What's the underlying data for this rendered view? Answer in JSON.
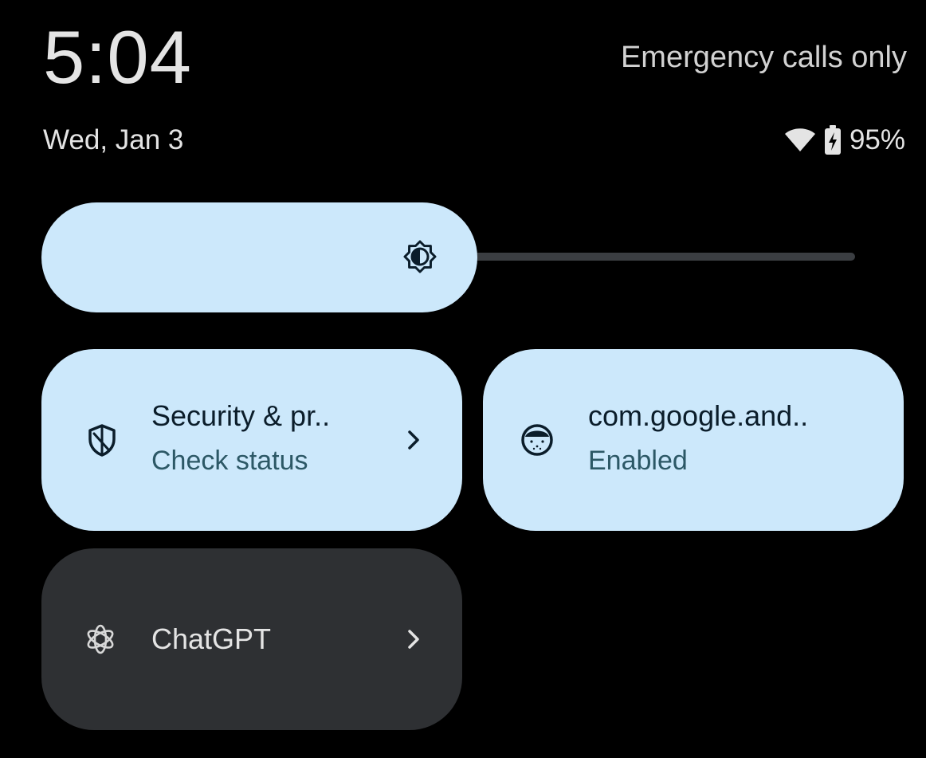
{
  "status_bar": {
    "time": "5:04",
    "carrier": "Emergency calls only",
    "date": "Wed, Jan 3",
    "battery": "95%",
    "icons": [
      "wifi-icon",
      "battery-charging-icon"
    ]
  },
  "brightness": {
    "icon": "brightness-icon",
    "level": 0.52
  },
  "tiles": [
    {
      "title": "Security & pr..",
      "subtitle": "Check status",
      "icon": "shield-icon",
      "has_chevron": true,
      "state": "active"
    },
    {
      "title": "com.google.and..",
      "subtitle": "Enabled",
      "icon": "android-face-icon",
      "has_chevron": false,
      "state": "active"
    },
    {
      "title": "ChatGPT",
      "subtitle": "",
      "icon": "chatgpt-icon",
      "has_chevron": true,
      "state": "inactive"
    }
  ],
  "colors": {
    "background": "#000000",
    "tile_active": "#cce8fb",
    "tile_inactive": "#2e3033",
    "subtitle_active": "#2c5866",
    "text_light": "#e4e4e4"
  }
}
